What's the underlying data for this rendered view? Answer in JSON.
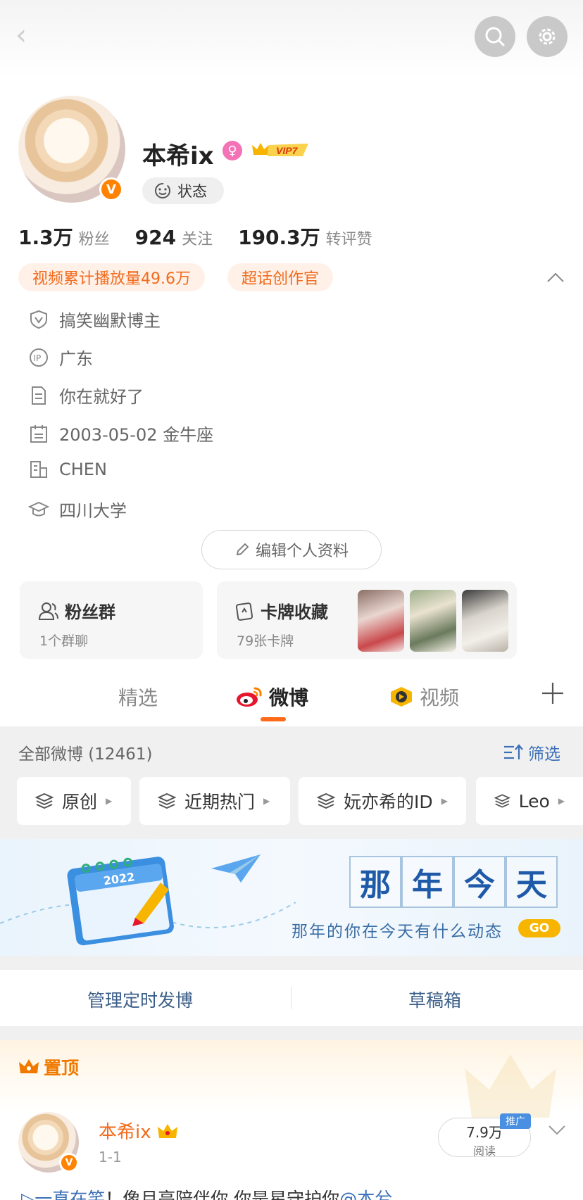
{
  "profile": {
    "username": "本希ix",
    "vip_label": "VIP7",
    "status_label": "状态",
    "stats": [
      {
        "num": "1.3万",
        "label": "粉丝"
      },
      {
        "num": "924",
        "label": "关注"
      },
      {
        "num": "190.3万",
        "label": "转评赞"
      }
    ],
    "tags": [
      "视频累计播放量49.6万",
      "超话创作官"
    ],
    "info": [
      {
        "icon": "shield-v-icon",
        "text": "搞笑幽默博主"
      },
      {
        "icon": "ip-icon",
        "text": "广东"
      },
      {
        "icon": "document-icon",
        "text": "你在就好了"
      },
      {
        "icon": "calendar-icon",
        "text": "2003-05-02 金牛座"
      },
      {
        "icon": "building-icon",
        "text": "CHEN"
      },
      {
        "icon": "graduation-cap-icon",
        "text": "四川大学"
      }
    ],
    "edit_label": "编辑个人资料"
  },
  "cards": {
    "fan_group": {
      "title": "粉丝群",
      "sub": "1个群聊"
    },
    "card_collection": {
      "title": "卡牌收藏",
      "sub": "79张卡牌"
    }
  },
  "tabs": [
    {
      "label": "精选"
    },
    {
      "label": "微博"
    },
    {
      "label": "视频"
    }
  ],
  "feed": {
    "all_label": "全部微博 (12461)",
    "filter_label": "筛选",
    "chips": [
      "原创",
      "近期热门",
      "妧亦希的ID",
      "Leo"
    ]
  },
  "banner": {
    "chars": [
      "那",
      "年",
      "今",
      "天"
    ],
    "subtitle": "那年的你在今天有什么动态",
    "go": "GO",
    "calendar_year": "2022"
  },
  "manage": {
    "schedule": "管理定时发博",
    "drafts": "草稿箱"
  },
  "pinned": {
    "label": "置顶",
    "name": "本希ix",
    "time": "1-1",
    "read_num": "7.9万",
    "read_label": "阅读",
    "promo": "推广",
    "text_prefix": "▷一直在笑",
    "text_body": "！像月亮陪伴你 你是星守护你",
    "text_mention": "@本兮"
  },
  "colors": {
    "accent": "#ff8200",
    "tag_text": "#f26b1d",
    "link": "#3b6fb6"
  }
}
